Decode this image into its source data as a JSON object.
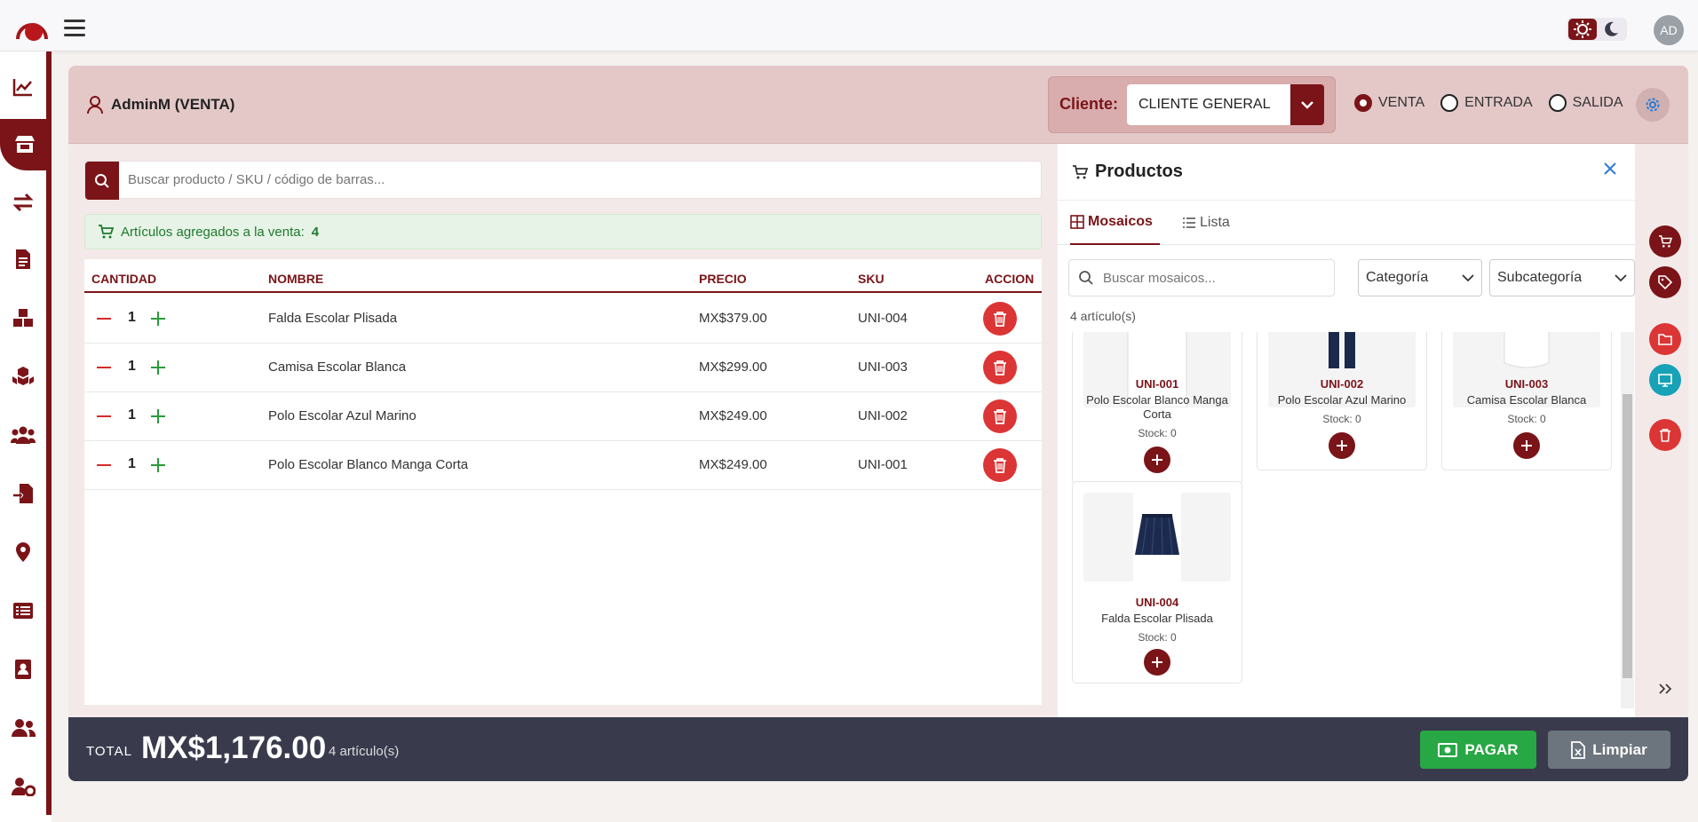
{
  "header": {
    "avatar_initials": "AD",
    "icons": [
      "menu-icon",
      "sun-icon",
      "moon-icon"
    ]
  },
  "sidebar": {
    "items": [
      "chart-line-icon",
      "store-icon",
      "exchange-icon",
      "document-icon",
      "boxes-icon",
      "cubes-icon",
      "users-icon",
      "file-import-icon",
      "location-icon",
      "list-icon",
      "contacts-icon",
      "user-group-icon",
      "user-gear-icon"
    ]
  },
  "sale": {
    "user": "AdminM (VENTA)",
    "client_label": "Cliente:",
    "client_value": "CLIENTE GENERAL",
    "modes": [
      "VENTA",
      "ENTRADA",
      "SALIDA"
    ],
    "selected_mode": "VENTA"
  },
  "search": {
    "placeholder": "Buscar producto / SKU / código de barras..."
  },
  "info": {
    "text": "Artículos agregados a la venta:",
    "count": "4"
  },
  "table": {
    "headers": [
      "CANTIDAD",
      "NOMBRE",
      "PRECIO",
      "SKU",
      "ACCION"
    ],
    "rows": [
      {
        "qty": "1",
        "name": "Falda Escolar Plisada",
        "price": "MX$379.00",
        "sku": "UNI-004"
      },
      {
        "qty": "1",
        "name": "Camisa Escolar Blanca",
        "price": "MX$299.00",
        "sku": "UNI-003"
      },
      {
        "qty": "1",
        "name": "Polo Escolar Azul Marino",
        "price": "MX$249.00",
        "sku": "UNI-002"
      },
      {
        "qty": "1",
        "name": "Polo Escolar Blanco Manga Corta",
        "price": "MX$249.00",
        "sku": "UNI-001"
      }
    ]
  },
  "products": {
    "title": "Productos",
    "tabs": [
      "Mosaicos",
      "Lista"
    ],
    "active_tab": "Mosaicos",
    "search_placeholder": "Buscar mosaicos...",
    "category": "Categoría",
    "subcategory": "Subcategoría",
    "count": "4 artículo(s)",
    "tiles": [
      {
        "sku": "UNI-001",
        "name": "Polo Escolar Blanco Manga Corta",
        "stock": "Stock: 0"
      },
      {
        "sku": "UNI-002",
        "name": "Polo Escolar Azul Marino",
        "stock": "Stock: 0"
      },
      {
        "sku": "UNI-003",
        "name": "Camisa Escolar Blanca",
        "stock": "Stock: 0"
      },
      {
        "sku": "UNI-004",
        "name": "Falda Escolar Plisada",
        "stock": "Stock: 0"
      }
    ]
  },
  "footer": {
    "total_label": "TOTAL",
    "total": "MX$1,176.00",
    "count": "4 artículo(s)",
    "pay": "PAGAR",
    "clear": "Limpiar"
  },
  "colors": {
    "brand": "#7a1418",
    "danger": "#dc3535",
    "success": "#28a745",
    "footer": "#393b4d",
    "teal": "#17a2b8"
  }
}
